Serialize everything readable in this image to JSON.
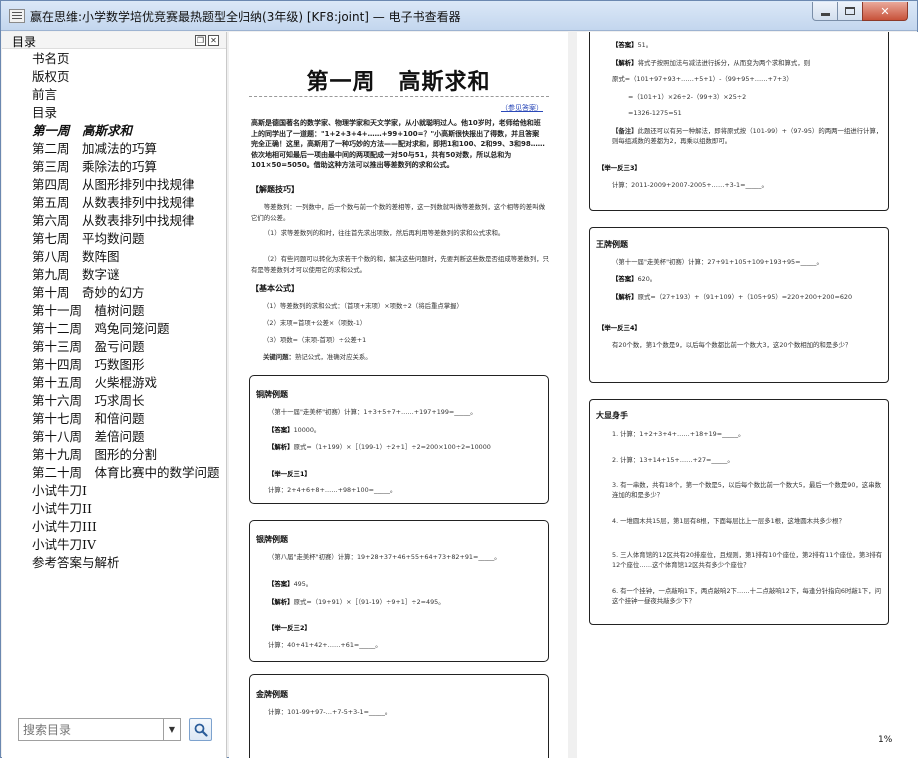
{
  "window": {
    "title": "赢在思维:小学数学培优竞赛最热题型全归纳(3年级) [KF8:joint] — 电子书查看器"
  },
  "toc": {
    "header": "目录",
    "items": [
      "书名页",
      "版权页",
      "前言",
      "目录",
      "第一周　高斯求和",
      "第二周　加减法的巧算",
      "第三周　乘除法的巧算",
      "第四周　从图形排列中找规律",
      "第五周　从数表排列中找规律",
      "第六周　从数表排列中找规律",
      "第七周　平均数问题",
      "第八周　数阵图",
      "第九周　数字谜",
      "第十周　奇妙的幻方",
      "第十一周　植树问题",
      "第十二周　鸡兔同笼问题",
      "第十三周　盈亏问题",
      "第十四周　巧数图形",
      "第十五周　火柴棍游戏",
      "第十六周　巧求周长",
      "第十七周　和倍问题",
      "第十八周　差倍问题",
      "第十九周　图形的分割",
      "第二十周　体育比赛中的数学问题",
      "小试牛刀I",
      "小试牛刀II",
      "小试牛刀III",
      "小试牛刀IV",
      "参考答案与解析"
    ],
    "active_index": 4
  },
  "search": {
    "placeholder": "搜索目录"
  },
  "page_left": {
    "chapter_title": "第一周　高斯求和",
    "link": "（参见答案）",
    "intro": "高斯是德国著名的数学家、物理学家和天文学家，从小就聪明过人。他10岁时，老师给他和班上的同学出了一道题：\"1+2+3+4+……+99+100=？\"小高斯很快报出了得数，并且答案完全正确！这里，高斯用了一种巧妙的方法——配对求和，即把1和100、2和99、3和98……依次地相可知最后一项由最中间的两项配成一对50与51，共有50对数，所以总和为101×50=5050。借助这种方法可以推出等差数列的求和公式。",
    "sec1": "【解题技巧】",
    "p1": "等差数列：一列数中，后一个数与前一个数的差相等，这一列数就叫做等差数列，这个相等的差叫做它们的公差。",
    "p2": "（1）求等差数列的和时，往往首先求出项数，然后再利用等差数列的求和公式求和。",
    "p3": "（2）有些问题可以转化为求若干个数的和，解决这些问题时，先要判断这些数是否组成等差数列，只有是等差数列才可以使用它的求和公式。",
    "sec2": "【基本公式】",
    "f1": "（1）等差数列的求和公式：（首项+末项）×项数÷2（将后重点掌握）",
    "f2": "（2）末项=首项+公差×（项数-1）",
    "f3": "（3）项数=（末项-首项）÷公差+1",
    "key_label": "关键问题：",
    "key_text": "熟记公式，准确对应关系。",
    "copper": {
      "title": "铜牌例题",
      "q": "（第十一届\"走美杯\"初赛）计算：1+3+5+7+……+197+199=_____。",
      "ans_label": "【答案】",
      "ans": "10000。",
      "sol_label": "【解析】",
      "sol": "原式=（1+199）×［（199-1）÷2+1］÷2=200×100÷2=10000",
      "sub_label": "【举一反三1】",
      "sub": "计算：2+4+6+8+……+98+100=_____。"
    },
    "silver": {
      "title": "银牌例题",
      "q": "（第八届\"走美杯\"初赛）计算：19+28+37+46+55+64+73+82+91=_____。",
      "ans_label": "【答案】",
      "ans": "495。",
      "sol_label": "【解析】",
      "sol": "原式=（19+91）×［（91-19）÷9+1］÷2=495。",
      "sub_label": "【举一反三2】",
      "sub": "计算：40+41+42+……+61=_____。"
    },
    "gold": {
      "title": "金牌例题",
      "q": "计算：101-99+97-…+7-5+3-1=_____。"
    }
  },
  "page_right": {
    "top": {
      "ans_label": "【答案】",
      "ans": "51。",
      "sol_label": "【解析】",
      "sol": "将式子按照加法与减法进行拆分，从而变为两个求和算式，则",
      "l1": "原式=（101+97+93+……+5+1）-（99+95+……+7+3）",
      "l2": "=（101+1）×26÷2-（99+3）×25÷2",
      "l3": "=1326-1275=51",
      "note_label": "【备注】",
      "note": "此题还可以有另一种解法，即将原式按（101-99）+（97-95）的两两一组进行计算，则每组减数的差都为2，再乘以组数即可。",
      "sub_label": "【举一反三3】",
      "sub": "计算：2011-2009+2007-2005+……+3-1=_____。"
    },
    "king": {
      "title": "王牌例题",
      "q": "（第十一届\"走美杯\"初赛）计算：27+91+105+109+193+95=_____。",
      "ans_label": "【答案】",
      "ans": "620。",
      "sol_label": "【解析】",
      "sol": "原式=（27+193）+（91+109）+（105+95）=220+200+200=620",
      "sub_label": "【举一反三4】",
      "sub": "有20个数，第1个数是9，以后每个数都比前一个数大3，这20个数相加的和是多少？"
    },
    "practice": {
      "title": "大显身手",
      "q1": "1. 计算：1+2+3+4+……+18+19=_____。",
      "q2": "2. 计算：13+14+15+……+27=_____。",
      "q3": "3. 有一串数，共有18个，第一个数是5，以后每个数比前一个数大5，最后一个数是90，这串数连加的和是多少？",
      "q4": "4. 一堆圆木共15层，第1层有8根，下面每层比上一层多1根，这堆圆木共多少根？",
      "q5": "5. 三人体育馆的12区共有20排座位，且规则，第1排有10个座位，第2排有11个座位，第3排有12个座位……这个体育馆12区共有多少个座位？",
      "q6": "6. 有一个挂钟，一点敲响1下，两点敲响2下……十二点敲响12下，每逢分针指向6时敲1下，问这个挂钟一昼夜共敲多少下？"
    }
  },
  "status": {
    "progress": "1%"
  }
}
